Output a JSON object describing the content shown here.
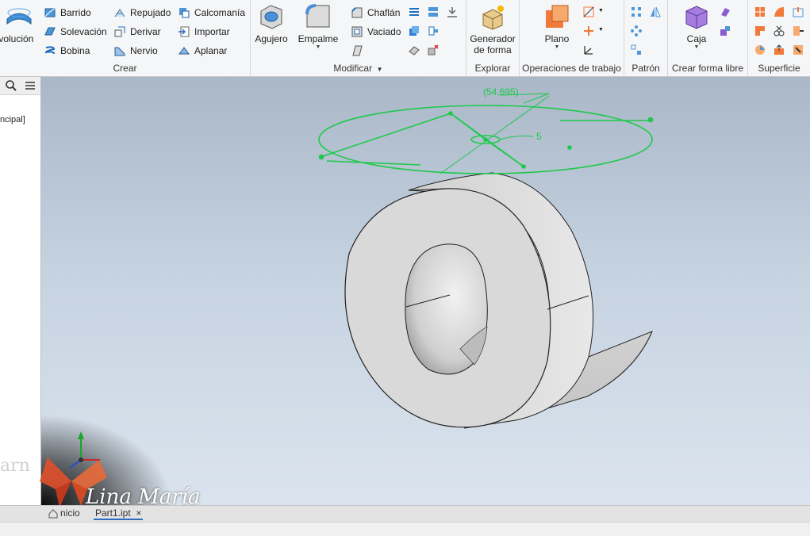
{
  "ribbon": {
    "crear": {
      "title": "Crear",
      "revolucion": "evolución",
      "barrido": "Barrido",
      "solevacion": "Solevación",
      "bobina": "Bobina",
      "repujado": "Repujado",
      "derivar": "Derivar",
      "nervio": "Nervio",
      "calcomania": "Calcomanía",
      "importar": "Importar",
      "aplanar": "Aplanar"
    },
    "modificar": {
      "title": "Modificar",
      "agujero": "Agujero",
      "empalme": "Empalme",
      "chaflan": "Chaflán",
      "vaciado": "Vaciado"
    },
    "explorar": {
      "title": "Explorar",
      "generador_line1": "Generador",
      "generador_line2": "de forma"
    },
    "operaciones": {
      "title": "Operaciones de trabajo",
      "plano": "Plano"
    },
    "patron": {
      "title": "Patrón"
    },
    "forma_libre": {
      "title": "Crear forma libre",
      "caja": "Caja"
    },
    "superficie": {
      "title": "Superficie"
    }
  },
  "browser": {
    "item": "ncipal]"
  },
  "viewport": {
    "dimension_diameter": "(54,695)",
    "dimension_small": "5",
    "sketch_color": "#1fc94a",
    "part_color": "#d9d9d9"
  },
  "tabs": {
    "home_fragment": "nicio",
    "document": "Part1.ipt"
  },
  "watermark": {
    "learn": "arn",
    "signature": "Lina María"
  }
}
